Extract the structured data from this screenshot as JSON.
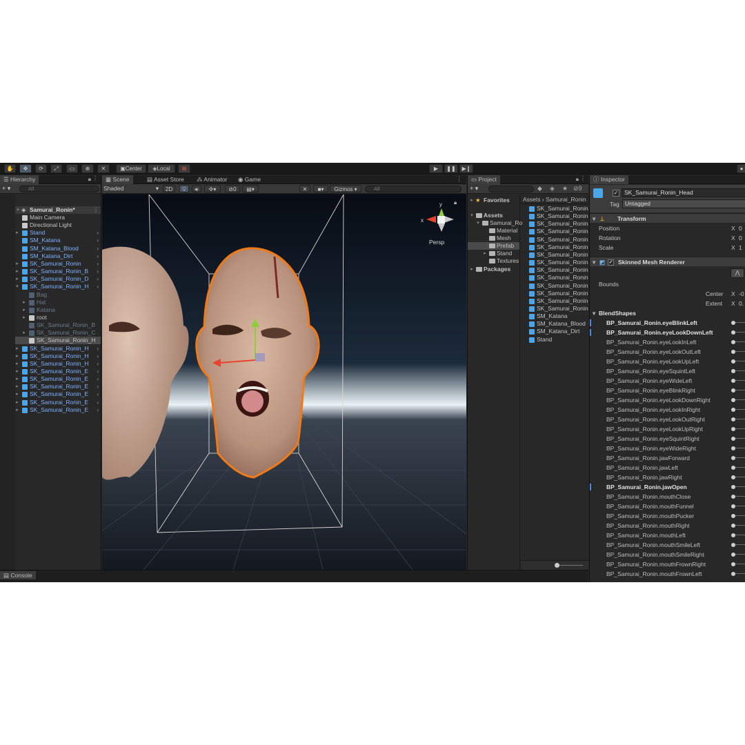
{
  "toolbar": {
    "center_label": "Center",
    "local_label": "Local"
  },
  "hierarchy": {
    "tab": "Hierarchy",
    "search_placeholder": "All",
    "add_label": "+ ▾",
    "root": "Samurai_Ronin*",
    "items": [
      {
        "label": "Main Camera",
        "style": "white",
        "depth": 1,
        "arrow": ""
      },
      {
        "label": "Directional Light",
        "style": "white",
        "depth": 1,
        "arrow": ""
      },
      {
        "label": "Stand",
        "style": "blue",
        "depth": 1,
        "arrow": "▸"
      },
      {
        "label": "SM_Katana",
        "style": "blue",
        "depth": 1,
        "arrow": ""
      },
      {
        "label": "SM_Katana_Blood",
        "style": "blue",
        "depth": 1,
        "arrow": ""
      },
      {
        "label": "SM_Katana_Dirt",
        "style": "blue",
        "depth": 1,
        "arrow": ""
      },
      {
        "label": "SK_Samurai_Ronin",
        "style": "blue",
        "depth": 1,
        "arrow": "▸"
      },
      {
        "label": "SK_Samurai_Ronin_B",
        "style": "blue",
        "depth": 1,
        "arrow": "▸"
      },
      {
        "label": "SK_Samurai_Ronin_D",
        "style": "blue",
        "depth": 1,
        "arrow": "▸"
      },
      {
        "label": "SK_Samurai_Ronin_H",
        "style": "blue",
        "depth": 1,
        "arrow": "▾"
      },
      {
        "label": "Bag",
        "style": "dim",
        "depth": 2,
        "arrow": ""
      },
      {
        "label": "Hat",
        "style": "dim",
        "depth": 2,
        "arrow": "▸"
      },
      {
        "label": "Katana",
        "style": "dim",
        "depth": 2,
        "arrow": "▸"
      },
      {
        "label": "root",
        "style": "white",
        "depth": 2,
        "arrow": "▸"
      },
      {
        "label": "SK_Samurai_Ronin_B",
        "style": "dim",
        "depth": 2,
        "arrow": ""
      },
      {
        "label": "SK_Samurai_Ronin_C",
        "style": "dim",
        "depth": 2,
        "arrow": "▸"
      },
      {
        "label": "SK_Samurai_Ronin_H",
        "style": "white",
        "depth": 2,
        "arrow": "",
        "selected": true
      },
      {
        "label": "SK_Samurai_Ronin_H",
        "style": "blue",
        "depth": 1,
        "arrow": "▸"
      },
      {
        "label": "SK_Samurai_Ronin_H",
        "style": "blue",
        "depth": 1,
        "arrow": "▸"
      },
      {
        "label": "SK_Samurai_Ronin_H",
        "style": "blue",
        "depth": 1,
        "arrow": "▸"
      },
      {
        "label": "SK_Samurai_Ronin_E",
        "style": "blue",
        "depth": 1,
        "arrow": "▸"
      },
      {
        "label": "SK_Samurai_Ronin_E",
        "style": "blue",
        "depth": 1,
        "arrow": "▸"
      },
      {
        "label": "SK_Samurai_Ronin_E",
        "style": "blue",
        "depth": 1,
        "arrow": "▸"
      },
      {
        "label": "SK_Samurai_Ronin_E",
        "style": "blue",
        "depth": 1,
        "arrow": "▸"
      },
      {
        "label": "SK_Samurai_Ronin_E",
        "style": "blue",
        "depth": 1,
        "arrow": "▸"
      },
      {
        "label": "SK_Samurai_Ronin_E",
        "style": "blue",
        "depth": 1,
        "arrow": "▸"
      }
    ]
  },
  "scene": {
    "tabs": [
      "Scene",
      "Asset Store",
      "Animator",
      "Game"
    ],
    "shading": "Shaded",
    "mode_2d": "2D",
    "hidden_count": "0",
    "gizmos": "Gizmos",
    "search_placeholder": "All",
    "persp": "Persp",
    "axis_y": "y",
    "axis_x": "x"
  },
  "project": {
    "tab": "Project",
    "count": "9",
    "favorites": "Favorites",
    "assets": "Assets",
    "packages": "Packages",
    "folder_tree": [
      "Samurai_Ro",
      "Material",
      "Mesh",
      "Prefab",
      "Stand",
      "Textures"
    ],
    "breadcrumb": [
      "Assets",
      "Samurai_Ronin"
    ],
    "files": [
      "SK_Samurai_Ronin",
      "SK_Samurai_Ronin",
      "SK_Samurai_Ronin",
      "SK_Samurai_Ronin",
      "SK_Samurai_Ronin",
      "SK_Samurai_Ronin",
      "SK_Samurai_Ronin",
      "SK_Samurai_Ronin",
      "SK_Samurai_Ronin",
      "SK_Samurai_Ronin",
      "SK_Samurai_Ronin",
      "SK_Samurai_Ronin",
      "SK_Samurai_Ronin",
      "SK_Samurai_Ronin",
      "SM_Katana",
      "SM_Katana_Blood",
      "SM_Katana_Dirt",
      "Stand"
    ]
  },
  "inspector": {
    "tab": "Inspector",
    "object_name": "SK_Samurai_Ronin_Head",
    "tag_label": "Tag",
    "tag_value": "Untagged",
    "transform": {
      "title": "Transform",
      "rows": [
        {
          "label": "Position",
          "axis": "X",
          "value": "0"
        },
        {
          "label": "Rotation",
          "axis": "X",
          "value": "0"
        },
        {
          "label": "Scale",
          "axis": "X",
          "value": "1"
        }
      ]
    },
    "renderer": {
      "title": "Skinned Mesh Renderer",
      "bounds": "Bounds",
      "center": "Center",
      "center_axis": "X",
      "center_value": "-0",
      "extent": "Extent",
      "extent_axis": "X",
      "extent_value": "0."
    },
    "blendshapes_title": "BlendShapes",
    "blendshapes": [
      {
        "name": "BP_Samurai_Ronin.eyeBlinkLeft",
        "bold": true
      },
      {
        "name": "BP_Samurai_Ronin.eyeLookDownLeft",
        "bold": true
      },
      {
        "name": "BP_Samurai_Ronin.eyeLookInLeft",
        "bold": false
      },
      {
        "name": "BP_Samurai_Ronin.eyeLookOutLeft",
        "bold": false
      },
      {
        "name": "BP_Samurai_Ronin.eyeLookUpLeft",
        "bold": false
      },
      {
        "name": "BP_Samurai_Ronin.eyeSquintLeft",
        "bold": false
      },
      {
        "name": "BP_Samurai_Ronin.eyeWideLeft",
        "bold": false
      },
      {
        "name": "BP_Samurai_Ronin.eyeBlinkRight",
        "bold": false
      },
      {
        "name": "BP_Samurai_Ronin.eyeLookDownRight",
        "bold": false
      },
      {
        "name": "BP_Samurai_Ronin.eyeLookInRight",
        "bold": false
      },
      {
        "name": "BP_Samurai_Ronin.eyeLookOutRight",
        "bold": false
      },
      {
        "name": "BP_Samurai_Ronin.eyeLookUpRight",
        "bold": false
      },
      {
        "name": "BP_Samurai_Ronin.eyeSquintRight",
        "bold": false
      },
      {
        "name": "BP_Samurai_Ronin.eyeWideRight",
        "bold": false
      },
      {
        "name": "BP_Samurai_Ronin.jawForward",
        "bold": false
      },
      {
        "name": "BP_Samurai_Ronin.jawLeft",
        "bold": false
      },
      {
        "name": "BP_Samurai_Ronin.jawRight",
        "bold": false
      },
      {
        "name": "BP_Samurai_Ronin.jawOpen",
        "bold": true
      },
      {
        "name": "BP_Samurai_Ronin.mouthClose",
        "bold": false
      },
      {
        "name": "BP_Samurai_Ronin.mouthFunnel",
        "bold": false
      },
      {
        "name": "BP_Samurai_Ronin.mouthPucker",
        "bold": false
      },
      {
        "name": "BP_Samurai_Ronin.mouthRight",
        "bold": false
      },
      {
        "name": "BP_Samurai_Ronin.mouthLeft",
        "bold": false
      },
      {
        "name": "BP_Samurai_Ronin.mouthSmileLeft",
        "bold": false
      },
      {
        "name": "BP_Samurai_Ronin.mouthSmileRight",
        "bold": false
      },
      {
        "name": "BP_Samurai_Ronin.mouthFrownRight",
        "bold": false
      },
      {
        "name": "BP_Samurai_Ronin.mouthFrownLeft",
        "bold": false
      }
    ]
  },
  "console": {
    "tab": "Console"
  },
  "colors": {
    "accent_blue": "#7fb2ff",
    "selection_orange": "#f07a1a",
    "panel_bg": "#282828"
  }
}
